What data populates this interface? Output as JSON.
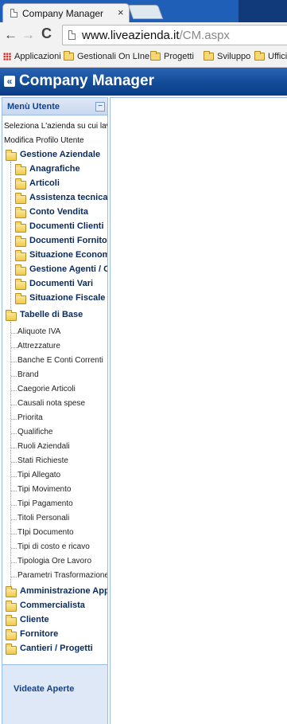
{
  "browser": {
    "tab_title": "Company Manager",
    "tab_close": "×",
    "nav_back": "←",
    "nav_forward": "→",
    "nav_reload": "C",
    "url_host": "www.liveazienda.it",
    "url_path": "/CM.aspx",
    "bookmarks": [
      {
        "label": "Applicazioni",
        "icon": "apps-icon"
      },
      {
        "label": "Gestionali On LIne",
        "icon": "folder-icon"
      },
      {
        "label": "Progetti",
        "icon": "folder-icon"
      },
      {
        "label": "Sviluppo",
        "icon": "folder-icon"
      },
      {
        "label": "Uffici",
        "icon": "folder-icon"
      }
    ]
  },
  "app": {
    "logo_glyph": "«",
    "title": "Company Manager"
  },
  "menu": {
    "title": "Menù Utente",
    "collapse_glyph": "−",
    "links": [
      "Seleziona L'azienda su cui lavora",
      "Modifica Profilo Utente"
    ],
    "gestione": {
      "label": "Gestione Aziendale",
      "children": [
        "Anagrafiche",
        "Articoli",
        "Assistenza tecnica",
        "Conto Vendita",
        "Documenti Clienti",
        "Documenti Fornitori",
        "Situazione Economica",
        "Gestione Agenti / Con",
        "Documenti Vari",
        "Situazione Fiscale"
      ]
    },
    "tabelle": {
      "label": "Tabelle di Base",
      "children": [
        "Aliquote IVA",
        "Attrezzature",
        "Banche E Conti Correnti",
        "Brand",
        "Caegorie Articoli",
        "Causali nota spese",
        "Priorita",
        "Qualifiche",
        "Ruoli Aziendali",
        "Stati Richieste",
        "Tipi Allegato",
        "Tipi Movimento",
        "Tipi Pagamento",
        "Titoli Personali",
        "TIpi Documento",
        "Tipi di costo e ricavo",
        "Tipologia Ore Lavoro",
        "Parametri Trasformazione D"
      ]
    },
    "other_folders": [
      "Amministrazione Applic",
      "Commercialista",
      "Cliente",
      "Fornitore",
      "Cantieri / Progetti"
    ],
    "videate_label": "Videate Aperte"
  }
}
